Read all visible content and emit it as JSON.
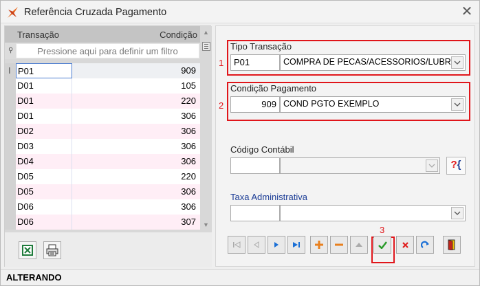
{
  "window": {
    "title": "Referência Cruzada Pagamento"
  },
  "grid": {
    "columns": [
      "Transação",
      "Condição"
    ],
    "filter_placeholder": "Pressione aqui para definir um filtro",
    "rows": [
      [
        "P01",
        "909"
      ],
      [
        "D01",
        "105"
      ],
      [
        "D01",
        "220"
      ],
      [
        "D01",
        "306"
      ],
      [
        "D02",
        "306"
      ],
      [
        "D03",
        "306"
      ],
      [
        "D04",
        "306"
      ],
      [
        "D05",
        "220"
      ],
      [
        "D05",
        "306"
      ],
      [
        "D06",
        "306"
      ],
      [
        "D06",
        "307"
      ]
    ]
  },
  "form": {
    "tipo_transacao": {
      "label": "Tipo Transação",
      "code": "P01",
      "description": "COMPRA DE PECAS/ACESSORIOS/LUBRI"
    },
    "condicao_pagamento": {
      "label": "Condição Pagamento",
      "code": "909",
      "description": "COND PGTO EXEMPLO"
    },
    "codigo_contabil": {
      "label": "Código Contábil",
      "code": "",
      "description": ""
    },
    "taxa_administrativa": {
      "label": "Taxa Administrativa",
      "code": "",
      "description": ""
    },
    "help_label": "?{"
  },
  "annotations": [
    "1",
    "2",
    "3"
  ],
  "status": {
    "text": "ALTERANDO"
  },
  "colors": {
    "highlight": "#e0151a",
    "blue_label": "#1c3d96",
    "nav_blue": "#1a6fd6",
    "add_orange": "#e8801f",
    "cancel_red": "#e02020",
    "confirm_green": "#2a9a2a"
  }
}
